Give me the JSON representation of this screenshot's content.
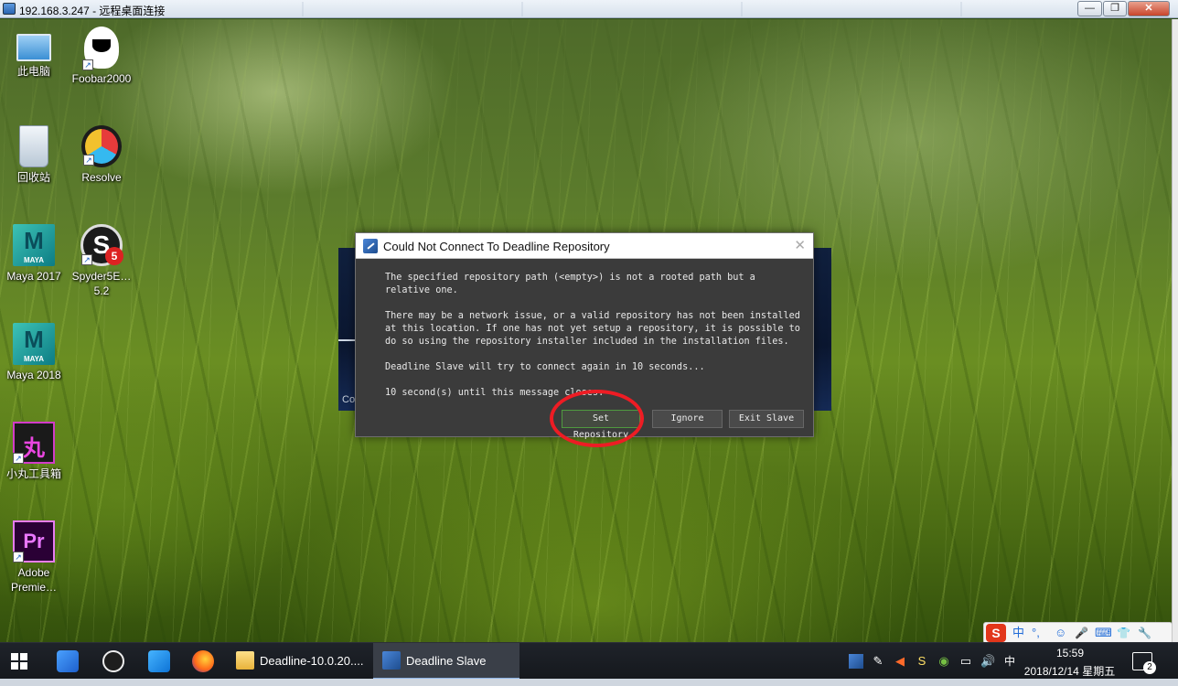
{
  "rdp": {
    "title": "192.168.3.247 - 远程桌面连接",
    "buttons": {
      "minimize": "—",
      "restore": "❐",
      "close": "✕"
    }
  },
  "desktop_icons": [
    {
      "label": "此电脑",
      "icon": "computer-icon"
    },
    {
      "label": "Foobar2000",
      "icon": "foobar-icon"
    },
    {
      "label": "回收站",
      "icon": "recycle-bin-icon"
    },
    {
      "label": "Resolve",
      "icon": "resolve-icon"
    },
    {
      "label": "Maya 2017",
      "icon": "maya-icon",
      "badge": "MAYA"
    },
    {
      "label": "Spyder5E… 5.2",
      "icon": "spyder-icon"
    },
    {
      "label": "Maya 2018",
      "icon": "maya-icon",
      "badge": "MAYA"
    },
    {
      "label": "小丸工具箱",
      "icon": "xiaowan-icon",
      "glyph": "丸"
    },
    {
      "label": "Adobe Premie…",
      "icon": "premiere-icon",
      "glyph": "Pr"
    }
  ],
  "background_window": {
    "text_fragment": "Co"
  },
  "dialog": {
    "title": "Could Not Connect To Deadline Repository",
    "close": "✕",
    "paragraphs": [
      "The specified repository path (<empty>) is not a rooted path but a relative one.",
      "There may be a network issue, or a valid repository has not been installed at this location. If one has not yet setup a repository, it is possible to do so using the repository installer included in the installation files.",
      "Deadline Slave will try to connect again in 10 seconds...",
      "10 second(s) until this message closes."
    ],
    "buttons": {
      "set_repository": "Set Repository",
      "ignore": "Ignore",
      "exit_slave": "Exit Slave"
    }
  },
  "taskbar": {
    "tasks": [
      {
        "label": "Deadline-10.0.20...."
      },
      {
        "label": "Deadline Slave",
        "active": true
      }
    ],
    "clock": {
      "time": "15:59",
      "date": "2018/12/14 星期五"
    },
    "ime_lang": "中",
    "notification_count": "2"
  },
  "ime_toolbar": {
    "logo": "S",
    "items": [
      "中",
      "°,",
      "☺",
      "🎤",
      "⌨",
      "👕",
      "🔧"
    ]
  },
  "colors": {
    "accent_red": "#ee1c24",
    "dialog_bg": "#3b3b3b",
    "taskbar_bg": "#1b1e24"
  }
}
